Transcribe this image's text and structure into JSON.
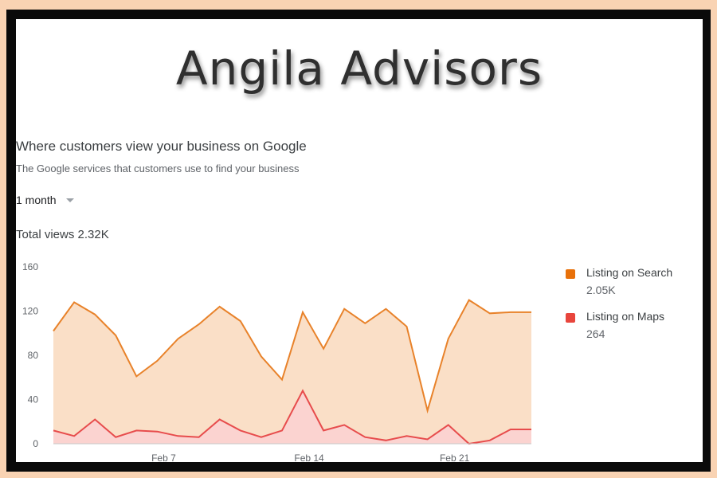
{
  "brand": "Angila Advisors",
  "card": {
    "title": "Where customers view your business on Google",
    "subtitle": "The Google services that customers use to find your business",
    "period": "1 month",
    "total_label": "Total views 2.32K"
  },
  "colors": {
    "search_line": "#e8822a",
    "search_fill": "#f9d9bd",
    "maps_line": "#e74c4c",
    "maps_fill": "#fbd2d0",
    "axis": "#c8c8c8"
  },
  "legend": [
    {
      "name": "Listing on Search",
      "value": "2.05K",
      "color": "#e8710a"
    },
    {
      "name": "Listing on Maps",
      "value": "264",
      "color": "#e8453c"
    }
  ],
  "chart_data": {
    "type": "area",
    "title": "Where customers view your business on Google",
    "xlabel": "",
    "ylabel": "",
    "ylim": [
      0,
      160
    ],
    "yticks": [
      0,
      40,
      80,
      120,
      160
    ],
    "x": [
      "Feb 1",
      "Feb 2",
      "Feb 3",
      "Feb 4",
      "Feb 5",
      "Feb 6",
      "Feb 7",
      "Feb 8",
      "Feb 9",
      "Feb 10",
      "Feb 11",
      "Feb 12",
      "Feb 13",
      "Feb 14",
      "Feb 15",
      "Feb 16",
      "Feb 17",
      "Feb 18",
      "Feb 19",
      "Feb 20",
      "Feb 21",
      "Feb 22",
      "Feb 23",
      "Feb 24"
    ],
    "xtick_labels": [
      {
        "index": 5,
        "label": "Feb 7"
      },
      {
        "index": 12,
        "label": "Feb 14"
      },
      {
        "index": 19,
        "label": "Feb 21"
      }
    ],
    "grid": false,
    "legend_position": "right",
    "series": [
      {
        "name": "Listing on Search",
        "values": [
          102,
          128,
          117,
          98,
          61,
          75,
          95,
          108,
          124,
          111,
          79,
          58,
          119,
          86,
          122,
          109,
          122,
          106,
          30,
          95,
          130,
          118,
          119,
          119
        ]
      },
      {
        "name": "Listing on Maps",
        "values": [
          12,
          7,
          22,
          6,
          12,
          11,
          7,
          6,
          22,
          12,
          6,
          12,
          48,
          12,
          17,
          6,
          3,
          7,
          4,
          17,
          0,
          3,
          13,
          13
        ]
      }
    ]
  }
}
